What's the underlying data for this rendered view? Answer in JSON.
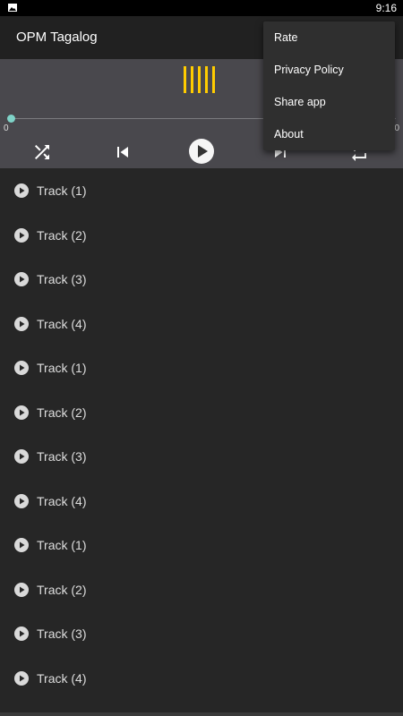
{
  "status_bar": {
    "time": "9:16",
    "icon": "image-icon"
  },
  "app_bar": {
    "title": "OPM Tagalog"
  },
  "player": {
    "time_start": "0",
    "time_end": "0",
    "progress": 0,
    "accent_color": "#ffcc00",
    "seek_color": "#7fd3c8",
    "controls": [
      "shuffle-icon",
      "skip-previous-icon",
      "play-icon",
      "skip-next-icon",
      "repeat-icon"
    ]
  },
  "tracks": [
    {
      "title": "Track (1)"
    },
    {
      "title": "Track (2)"
    },
    {
      "title": "Track (3)"
    },
    {
      "title": "Track (4)"
    },
    {
      "title": "Track (1)"
    },
    {
      "title": "Track (2)"
    },
    {
      "title": "Track (3)"
    },
    {
      "title": "Track (4)"
    },
    {
      "title": "Track (1)"
    },
    {
      "title": "Track (2)"
    },
    {
      "title": "Track (3)"
    },
    {
      "title": "Track (4)"
    }
  ],
  "menu": {
    "items": [
      {
        "label": "Rate"
      },
      {
        "label": "Privacy Policy"
      },
      {
        "label": "Share app"
      },
      {
        "label": "About"
      }
    ]
  }
}
